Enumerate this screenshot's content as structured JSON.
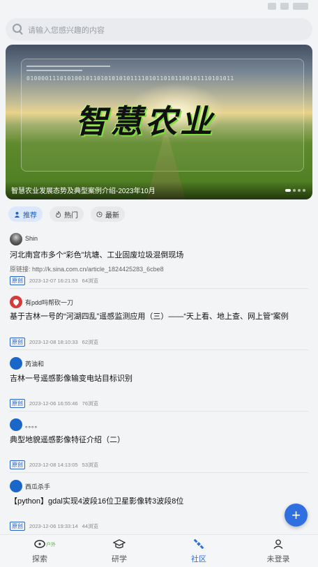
{
  "search": {
    "placeholder": "请输入您感兴趣的内容"
  },
  "banner": {
    "headline": "智慧农业",
    "binary": "01000011101010010110101010101111010110101100101110101011",
    "caption": "智慧农业发展态势及典型案例介绍-2023年10月",
    "slide_count": 4,
    "active_slide": 1
  },
  "tabs": [
    {
      "label": "推荐",
      "icon": "person-icon",
      "active": true
    },
    {
      "label": "热门",
      "icon": "flame-icon",
      "active": false
    },
    {
      "label": "最新",
      "icon": "clock-icon",
      "active": false
    }
  ],
  "posts": [
    {
      "author": "Shin",
      "avatar": "photo",
      "title": "河北南宫市多个“彩色”坑塘、工业固废垃圾混倒现场",
      "sub": "原链接: http://k.sina.com.cn/article_1824425283_6cbe8",
      "badge": "原创",
      "time": "2023-12-07 16:21:53",
      "views": "64浏览"
    },
    {
      "author": "有pdd吗帮砍一刀",
      "avatar": "red",
      "title": "基于吉林一号的“河湖四乱”遥感监测应用（三）——“天上看、地上查、网上管”案例",
      "sub": "",
      "badge": "原创",
      "time": "2023-12-08 18:10:33",
      "views": "62浏览"
    },
    {
      "author": "芮油和",
      "avatar": "blue",
      "title": "吉林一号遥感影像输变电站目标识别",
      "sub": "",
      "badge": "原创",
      "time": "2023-12-06 16:55:46",
      "views": "76浏览"
    },
    {
      "author": "。。。。",
      "avatar": "blue",
      "title": "典型地貌遥感影像特征介绍（二）",
      "sub": "",
      "badge": "原创",
      "time": "2023-12-08 14:13:05",
      "views": "53浏览"
    },
    {
      "author": "西瓜杀手",
      "avatar": "blue",
      "title": "【python】gdal实现4波段16位卫星影像转3波段8位",
      "sub": "",
      "badge": "原创",
      "time": "2023-12-06 19:33:14",
      "views": "44浏览"
    }
  ],
  "fab": {
    "label": "+"
  },
  "bottom_nav": [
    {
      "label": "探索",
      "icon": "explore-icon",
      "badge": "户外",
      "active": false
    },
    {
      "label": "研学",
      "icon": "graduation-cap-icon",
      "active": false
    },
    {
      "label": "社区",
      "icon": "satellite-icon",
      "active": true
    },
    {
      "label": "未登录",
      "icon": "user-icon",
      "active": false
    }
  ],
  "colors": {
    "accent": "#2f6fe0",
    "badge": "#2a63c4",
    "banner_glow": "#7dde3c"
  }
}
